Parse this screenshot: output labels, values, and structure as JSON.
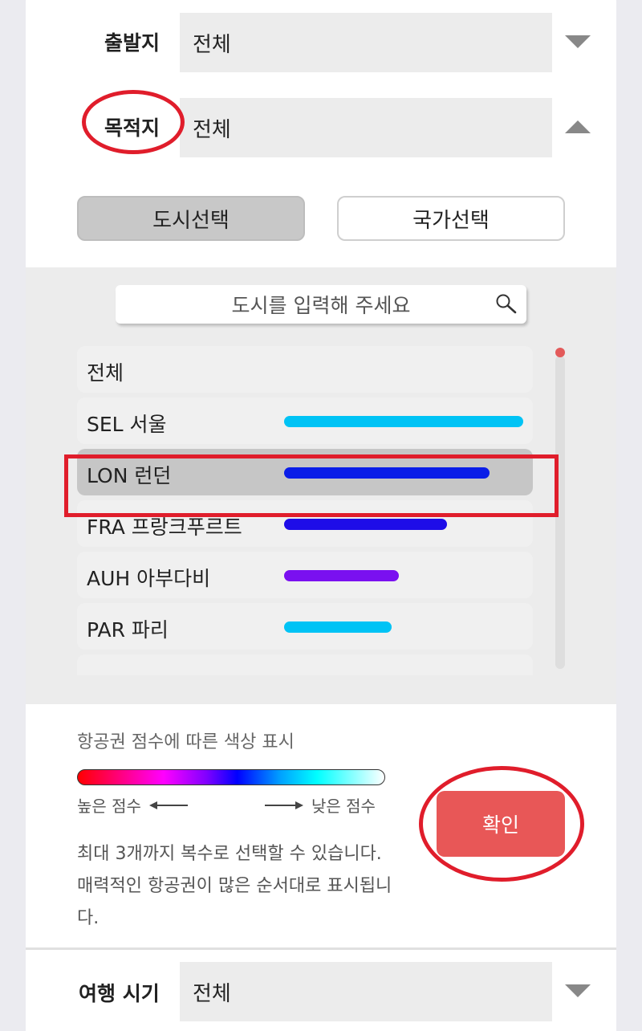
{
  "origin": {
    "label": "출발지",
    "value": "전체"
  },
  "destination": {
    "label": "목적지",
    "value": "전체"
  },
  "mode_buttons": {
    "city": "도시선택",
    "country": "국가선택"
  },
  "search": {
    "placeholder": "도시를 입력해 주세요"
  },
  "city_list": [
    {
      "label": "전체",
      "score": null,
      "color": null,
      "selected": false
    },
    {
      "label": "SEL 서울",
      "score": 1.0,
      "color": "#00c3f5",
      "selected": false
    },
    {
      "label": "LON 런던",
      "score": 0.86,
      "color": "#0a1de8",
      "selected": true
    },
    {
      "label": "FRA 프랑크푸르트",
      "score": 0.68,
      "color": "#1e0de8",
      "selected": false
    },
    {
      "label": "AUH 아부다비",
      "score": 0.48,
      "color": "#7a10f0",
      "selected": false
    },
    {
      "label": "PAR 파리",
      "score": 0.45,
      "color": "#00c3f5",
      "selected": false
    }
  ],
  "legend": {
    "title": "항공권 점수에 따른 색상 표시",
    "high": "높은 점수",
    "low": "낮은 점수"
  },
  "note": "최대 3개까지 복수로 선택할 수 있습니다. 매력적인 항공권이 많은 순서대로 표시됩니다.",
  "confirm_label": "확인",
  "travel_period": {
    "label": "여행 시기",
    "value": "전체"
  },
  "colors": {
    "accent": "#e85757",
    "annotation": "#e01d2b"
  }
}
